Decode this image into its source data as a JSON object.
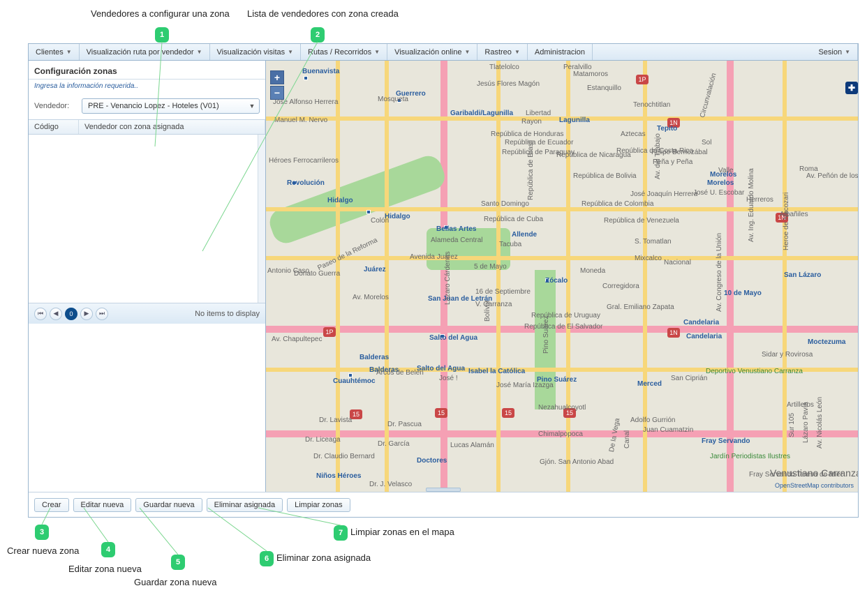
{
  "annotations": {
    "a1_title": "Vendedores a configurar una zona",
    "a2_title": "Lista de vendedores con zona creada",
    "a3_title": "Crear nueva zona",
    "a4_title": "Editar zona nueva",
    "a5_title": "Guardar zona nueva",
    "a6_title": "Eliminar zona asignada",
    "a7_title": "Limpiar zonas en el mapa",
    "n1": "1",
    "n2": "2",
    "n3": "3",
    "n4": "4",
    "n5": "5",
    "n6": "6",
    "n7": "7"
  },
  "menu": {
    "clientes": "Clientes",
    "ruta_vend": "Visualización ruta por vendedor",
    "visitas": "Visualización visitas",
    "rutas": "Rutas / Recorridos",
    "online": "Visualización online",
    "rastreo": "Rastreo",
    "admin": "Administracion",
    "sesion": "Sesion"
  },
  "panel": {
    "title": "Configuración zonas",
    "hint": "Ingresa la información requerida..",
    "vend_label": "Vendedor:",
    "vend_value": "PRE - Venancio Lopez - Hoteles (V01)",
    "col_codigo": "Código",
    "col_vendzona": "Vendedor con zona asignada",
    "pager_status": "No items to display",
    "pg0": "0"
  },
  "buttons": {
    "crear": "Crear",
    "editar": "Editar nueva",
    "guardar": "Guardar nueva",
    "eliminar": "Eliminar asignada",
    "limpiar": "Limpiar zonas"
  },
  "map": {
    "zoom_in": "+",
    "zoom_out": "−",
    "expand": "✚",
    "attribution": "OpenStreetMap contributors",
    "labels": {
      "buenavista": "Buenavista",
      "guerrero": "Guerrero",
      "lagunilla": "Lagunilla",
      "gari": "Garibaldi/Lagunilla",
      "tepito": "Tepito",
      "morelos": "Morelos",
      "revolucion": "Revolución",
      "hidalgo": "Hidalgo",
      "hidalgo2": "Hidalgo",
      "bellasartes": "Bellas Artes",
      "allende": "Allende",
      "juarez": "Juárez",
      "alameda": "Alameda Central",
      "cuauhtemoc": "Cuauhtémoc",
      "balderas": "Balderas",
      "balderas2": "Balderas",
      "saltoagua": "Salto del Agua",
      "saltoagua2": "Salto del Agua",
      "isabel": "Isabel la Católica",
      "zocalo": "Zócalo",
      "merced": "Merced",
      "pinosuarez": "Pino Suárez",
      "pinosuarez2": "Pino Suárez",
      "sanjuanletran": "San Juan de Letrán",
      "sanlazaro": "San Lázaro",
      "candelaria": "Candelaria",
      "candelaria2": "Candelaria",
      "moctezuma": "Moctezuma",
      "doctores": "Doctores",
      "ninosh": "Niños Héroes",
      "josemi": "José María Izazga",
      "frayservando": "Fray Servando",
      "vcarranza": "Venustiano Carranza",
      "jardinper": "Jardín Periodistas Ilustres",
      "paseo": "Paseo de la Reforma",
      "tlatelolco": "Tlatelolco",
      "mosqueta": "Mosqueta",
      "rayon": "Rayon",
      "avjuarez": "Avenida Juárez",
      "avchap": "Av. Chapultepec",
      "arcos": "Arcos de Belen",
      "jose_l": "José !",
      "libertad": "Libertad",
      "diezmayo": "10 de Mayo",
      "albañiles": "Albañiles",
      "heroe_nacozari": "Heroe de Nacozari",
      "sidar": "Sidar y Rovirosa",
      "lazarocard": "Lázaro Cárdenas",
      "tacuba": "Tacuba",
      "avmorelos": "Av. Morelos",
      "smayo": "5 de Mayo",
      "sept16": "16 de Septiembre",
      "vcarranza2": "V. Carranza",
      "drlavista": "Dr. Lavista",
      "drbernard": "Dr. Claudio Bernard",
      "bolivar": "Bolívar",
      "rep_uruguay": "República de Uruguay",
      "rep_salvador": "República de El Salvador",
      "rep_cuba": "República de Cuba",
      "rep_vene": "República de Venezuela",
      "rep_hond": "República de Honduras",
      "rep_ecu": "República de Ecuador",
      "rep_para": "República de Paraguay",
      "rep_nica": "República de Nicaragua",
      "rep_costarica": "República de Costa Rica",
      "rep_brasil": "República de Brasil",
      "rep_bolivia": "República de Bolivia",
      "rep_dom": "Santo Domingo",
      "rep_colombia": "República de Colombia",
      "colon": "Colón",
      "donato": "Donato Guerra",
      "antonio_caso": "Antonio Caso",
      "roma": "Roma",
      "penabeta": "Peña y Peña",
      "eduardo_molina": "Av. Ing. Eduardo Molina",
      "congreso": "Av. Congreso de la Unión",
      "circunvalacion": "Circunvalación",
      "chimal": "Chimalpopoca",
      "drgv": "Dr. J. Velasco",
      "drpascua": "Dr. Pascua",
      "s_antonio": "Gjón. San Antonio Abad",
      "moneda": "Moneda",
      "delavega": "De la Vega",
      "canal": "Canal",
      "sancipran": "San Ciprián",
      "emiliano": "Gral. Emiliano Zapata",
      "adolfo_gurrion": "Adolfo Gurrión",
      "juancuam": "Juan Cuamatzin",
      "floresmag": "Jesús Flores Magón",
      "peralvillo": "Peralvillo",
      "matamoros": "Matamoros",
      "estanquillo": "Estanquillo",
      "alfonsoh": "José Alfonso Herrera",
      "mmnervo": "Manuel M. Nervo",
      "lucasa": "Lucas Alamán",
      "drliceaga": "Dr. Liceaga",
      "drgarcia": "Dr. García",
      "penonbanos": "Av. Peñón de los Baños",
      "joseJQ": "José Joaquín Herrera",
      "felipeberri": "Felipe Berriozábal",
      "sol": "Sol",
      "aztecas": "Aztecas",
      "valle": "Valle",
      "tenochtitlan": "Tenochtitlan",
      "sanantonio_tomatlan": "S. Tomatlan",
      "herreros": "Herreros",
      "mixcalco": "Mixcalco",
      "corregidora": "Corregidora",
      "avdeltrabajo": "Av. del Trabajo",
      "nacional": "Nacional",
      "nezahualcoyotl": "Nezahualcoyotl",
      "heroesf": "Héroes Ferrocarrileros",
      "huehueteotl": "José U. Escobar",
      "artilleros": "Artilleros",
      "avnicleon": "Av. Nicolás León",
      "lazaropav": "Lázaro Pavía",
      "sur105": "Sur 105",
      "fst": "Fray Servando Teresa de Mier",
      "dep_vcarranza": "Deportivo Venustiano Carranza",
      "s15": "15",
      "s1n": "1N",
      "s1p": "1P"
    }
  }
}
